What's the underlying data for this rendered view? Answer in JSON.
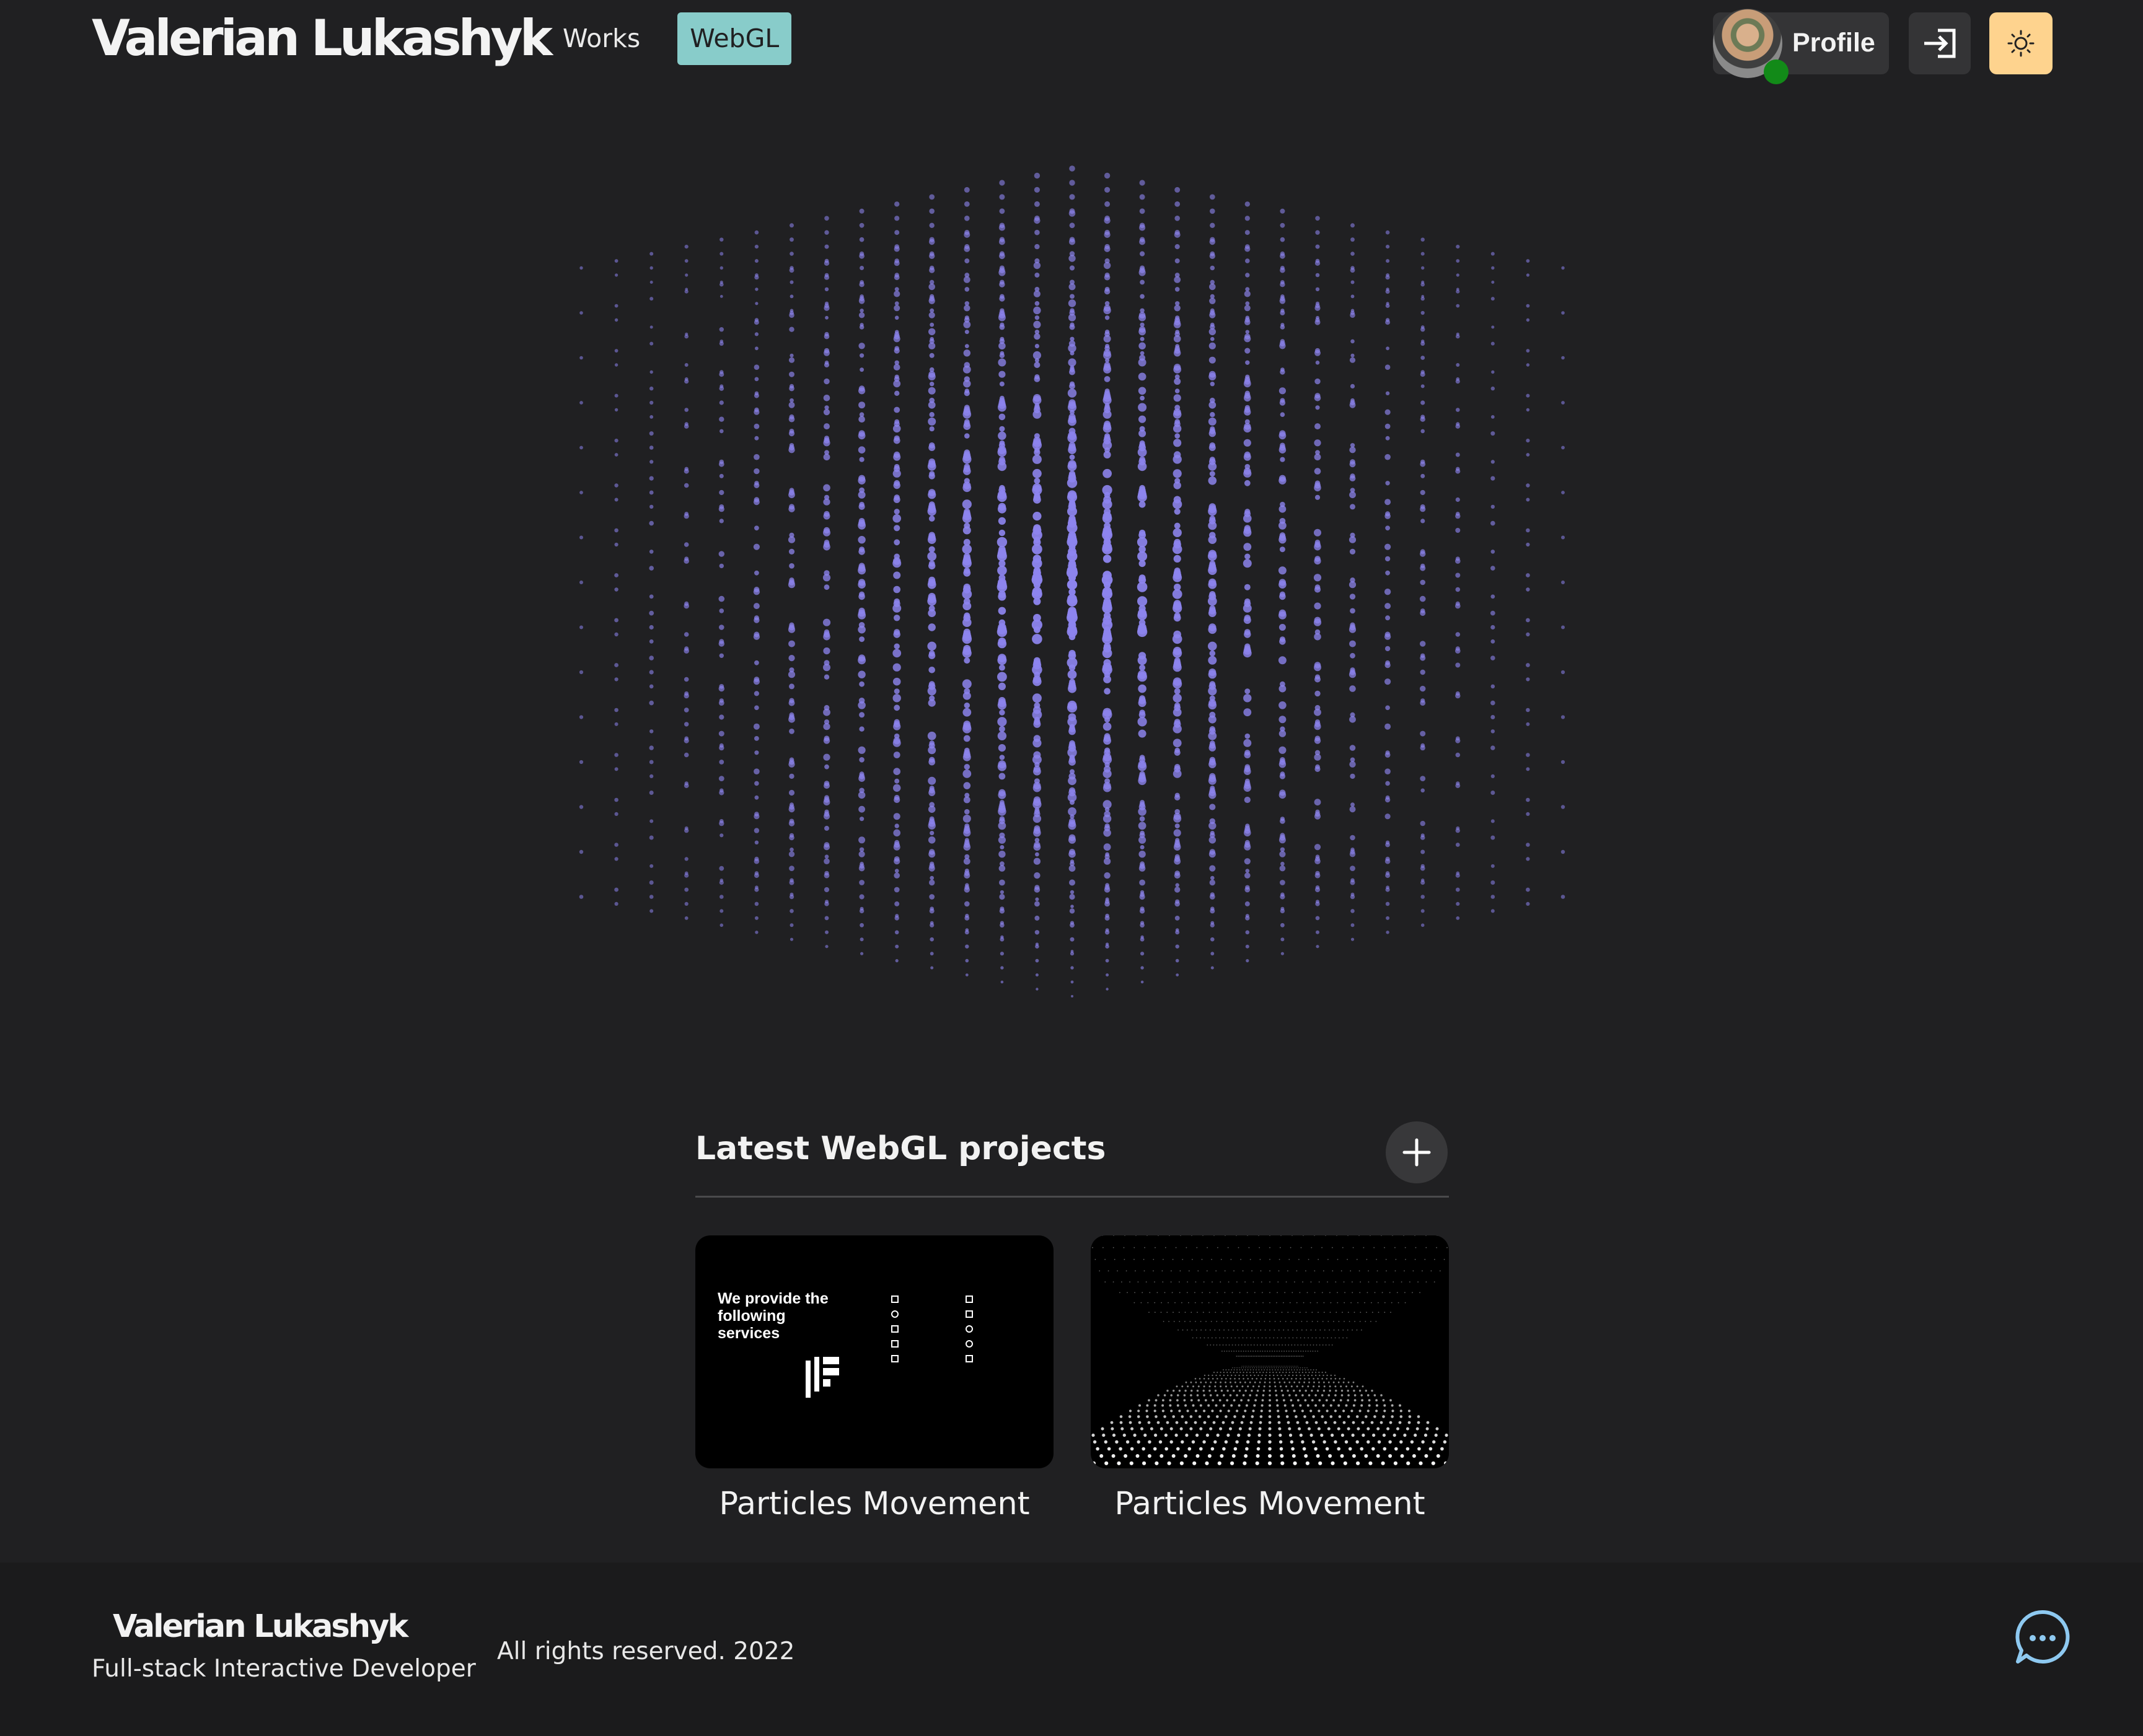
{
  "header": {
    "brand": "Valerian Lukashyk",
    "nav": [
      {
        "label": "Works",
        "active": false
      },
      {
        "label": "WebGL",
        "active": true
      }
    ],
    "profile_label": "Profile",
    "icons": {
      "login": "login-icon",
      "theme": "sun-icon"
    },
    "colors": {
      "active_nav": "#88ccca",
      "theme_button": "#fed38e",
      "online": "#128a18"
    }
  },
  "hero": {
    "visual": "particle-cube",
    "particle_color": "#8d84ee"
  },
  "projects": {
    "title": "Latest WebGL projects",
    "add_icon": "plus-icon",
    "items": [
      {
        "title": "Particles Movement",
        "preview_heading": "We provide the following services"
      },
      {
        "title": "Particles Movement",
        "preview_heading": ""
      }
    ]
  },
  "footer": {
    "brand": "Valerian Lukashyk",
    "subtitle": "Full-stack Interactive Developer",
    "rights": "All rights reserved. 2022",
    "chat_icon": "chat-bubble-icon",
    "chat_color": "#8ec9f0"
  }
}
